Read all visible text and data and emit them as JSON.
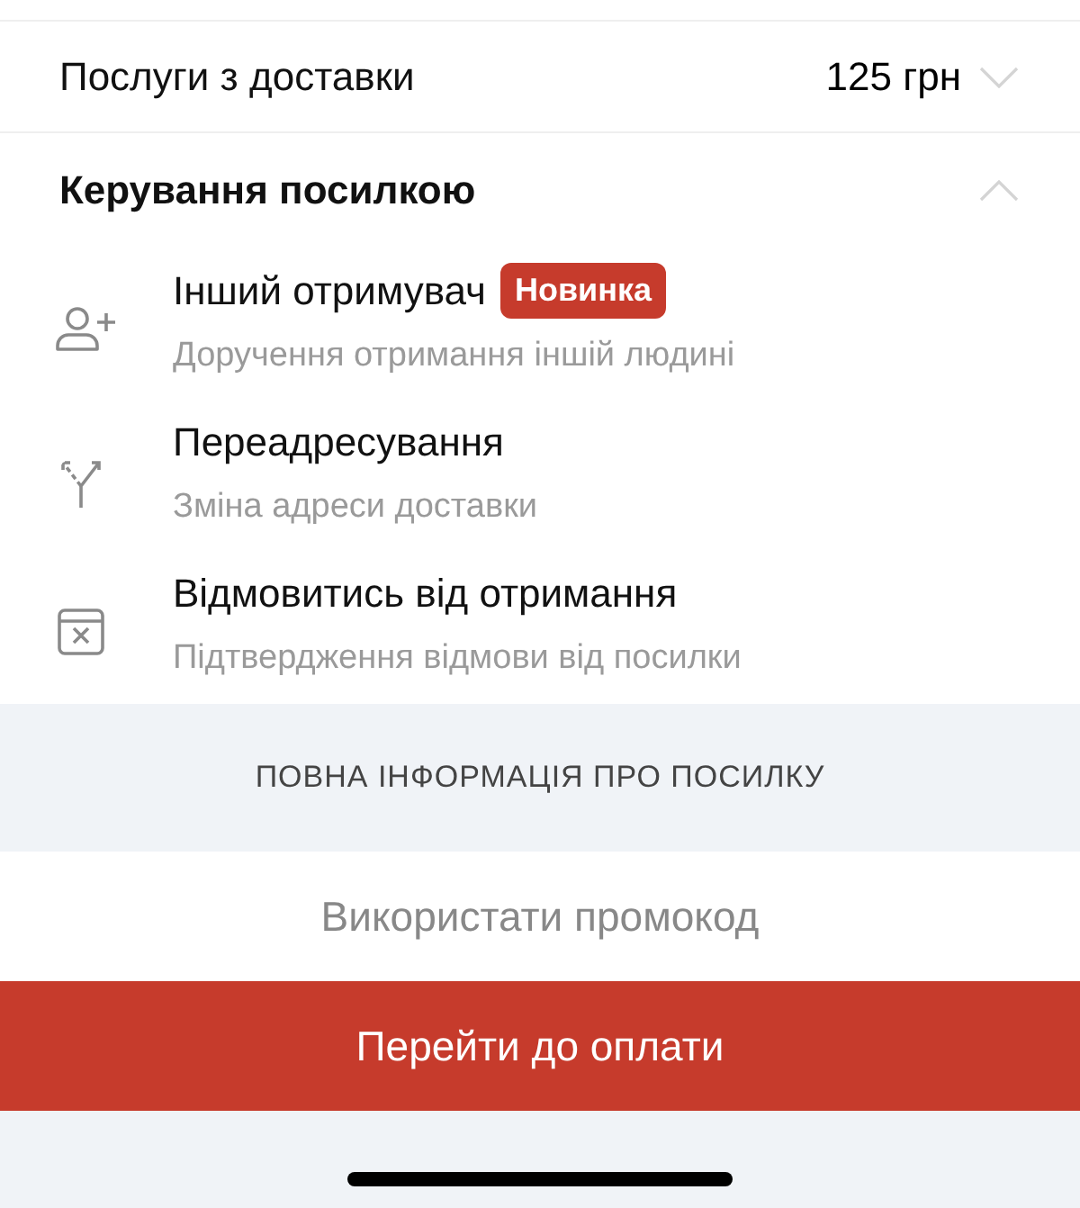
{
  "delivery_services": {
    "label": "Послуги з доставки",
    "price": "125 грн",
    "expanded": false
  },
  "parcel_management": {
    "title": "Керування посилкою",
    "expanded": true,
    "items": [
      {
        "kind": "person-add",
        "title": "Інший отримувач",
        "badge": "Новинка",
        "subtitle": "Доручення отримання іншій людині"
      },
      {
        "kind": "fork",
        "title": "Переадресування",
        "subtitle": "Зміна адреси доставки"
      },
      {
        "kind": "box-x",
        "title": "Відмовитись від отримання",
        "subtitle": "Підтвердження відмови від посилки"
      }
    ]
  },
  "full_info_link": "ПОВНА ІНФОРМАЦІЯ ПРО ПОСИЛКУ",
  "promo_button": "Використати промокод",
  "pay_button": "Перейти до оплати"
}
